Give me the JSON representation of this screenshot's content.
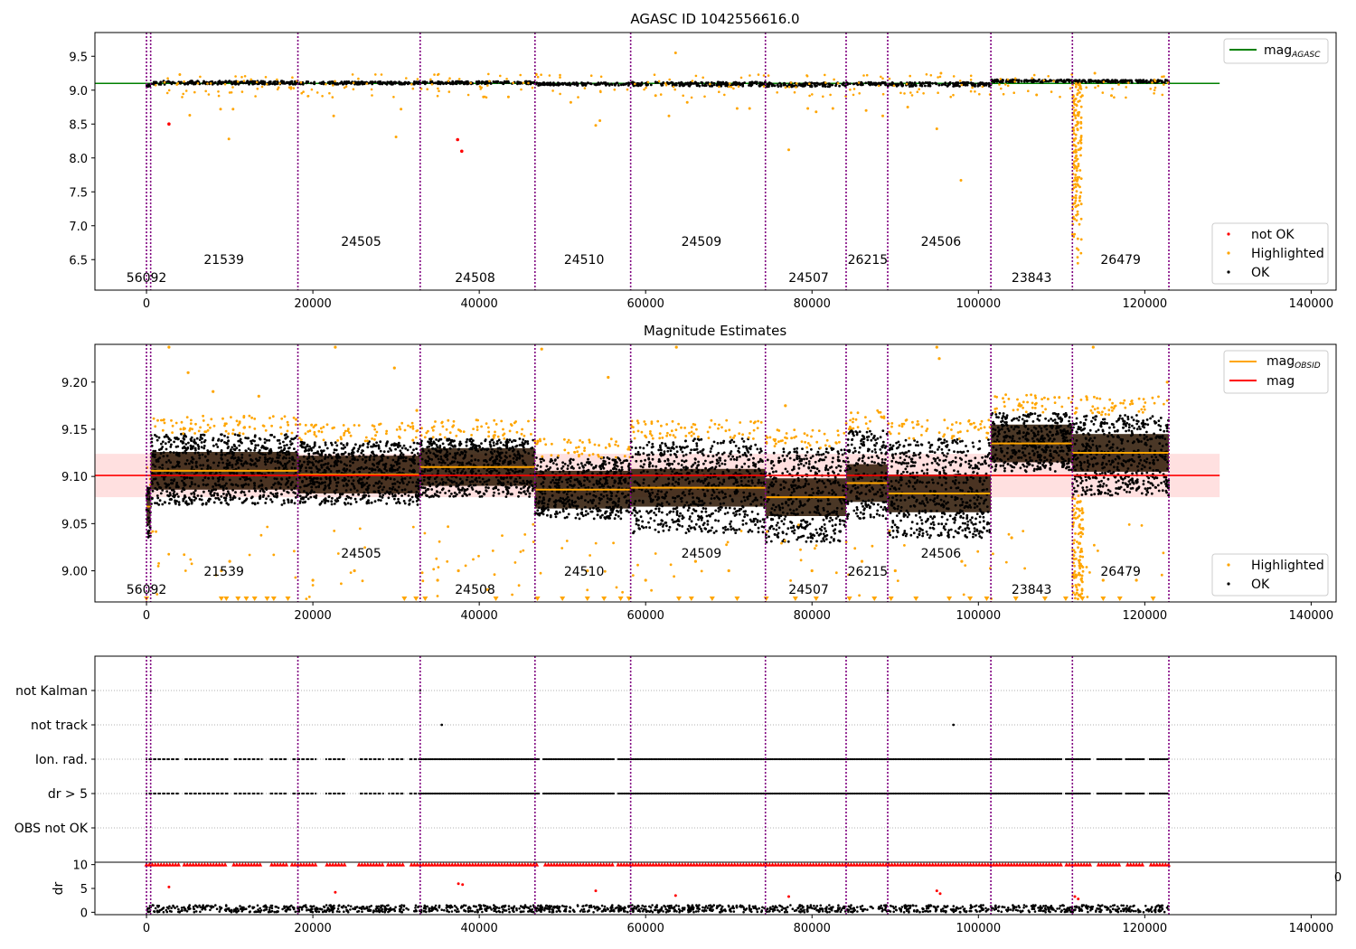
{
  "chart_data": [
    {
      "id": "agasc",
      "type": "scatter",
      "title": "AGASC ID 1042556616.0",
      "xlim": [
        -6200,
        143000
      ],
      "ylim": [
        6.05,
        9.85
      ],
      "xticks": [
        0,
        20000,
        40000,
        60000,
        80000,
        100000,
        120000,
        140000
      ],
      "yticks": [
        9.5,
        9.0,
        8.5,
        8.0,
        7.5,
        7.0,
        6.5
      ],
      "reference_line": {
        "name": "mag_AGASC",
        "value": 9.1,
        "x": [
          -6200,
          129000
        ],
        "color": "#008000"
      },
      "legend_line": {
        "label_main": "mag",
        "label_sub": "AGASC"
      },
      "legend_points": [
        {
          "label": "not OK",
          "color": "#ff0000"
        },
        {
          "label": "Highlighted",
          "color": "#ffa500"
        },
        {
          "label": "OK",
          "color": "#000000"
        }
      ],
      "segments": [
        {
          "x0": 0,
          "x1": 500,
          "median": 9.07,
          "spread": 0.02
        },
        {
          "x0": 500,
          "x1": 18200,
          "median": 9.11,
          "spread": 0.025
        },
        {
          "x0": 18200,
          "x1": 32900,
          "median": 9.105,
          "spread": 0.02
        },
        {
          "x0": 32900,
          "x1": 46700,
          "median": 9.11,
          "spread": 0.02
        },
        {
          "x0": 46700,
          "x1": 58200,
          "median": 9.09,
          "spread": 0.02
        },
        {
          "x0": 58200,
          "x1": 74400,
          "median": 9.09,
          "spread": 0.03
        },
        {
          "x0": 74400,
          "x1": 84100,
          "median": 9.08,
          "spread": 0.03
        },
        {
          "x0": 84100,
          "x1": 89100,
          "median": 9.095,
          "spread": 0.02
        },
        {
          "x0": 89100,
          "x1": 101500,
          "median": 9.085,
          "spread": 0.03
        },
        {
          "x0": 101500,
          "x1": 111300,
          "median": 9.135,
          "spread": 0.02
        },
        {
          "x0": 111300,
          "x1": 122900,
          "median": 9.13,
          "spread": 0.02
        }
      ],
      "not_ok_points": [
        [
          2700,
          8.5
        ],
        [
          37400,
          8.27
        ],
        [
          37900,
          8.1
        ]
      ],
      "highlighted_points": [
        [
          4000,
          9.23
        ],
        [
          5200,
          8.63
        ],
        [
          8900,
          8.72
        ],
        [
          9900,
          8.28
        ],
        [
          10400,
          8.72
        ],
        [
          22500,
          8.62
        ],
        [
          30000,
          8.31
        ],
        [
          30600,
          8.72
        ],
        [
          40500,
          8.9
        ],
        [
          43500,
          8.9
        ],
        [
          51000,
          8.82
        ],
        [
          54000,
          8.48
        ],
        [
          54500,
          8.55
        ],
        [
          61200,
          8.92
        ],
        [
          62800,
          8.62
        ],
        [
          63600,
          9.55
        ],
        [
          65000,
          8.82
        ],
        [
          71000,
          8.73
        ],
        [
          72500,
          8.73
        ],
        [
          77200,
          8.12
        ],
        [
          79500,
          8.73
        ],
        [
          80500,
          8.68
        ],
        [
          82500,
          8.73
        ],
        [
          86500,
          8.7
        ],
        [
          88500,
          8.62
        ],
        [
          91500,
          8.75
        ],
        [
          95000,
          8.43
        ],
        [
          95500,
          9.25
        ],
        [
          97900,
          7.67
        ],
        [
          107000,
          8.93
        ],
        [
          112500,
          8.92
        ],
        [
          114000,
          9.25
        ],
        [
          116000,
          8.92
        ]
      ],
      "dip": {
        "x0": 111300,
        "x1": 112400,
        "y_min": 6.35,
        "y_max": 9.1
      },
      "obsids": [
        {
          "label": "56092",
          "x": 0,
          "row": 0
        },
        {
          "label": "21539",
          "x": 9300,
          "row": 1
        },
        {
          "label": "24505",
          "x": 25800,
          "row": 2
        },
        {
          "label": "24508",
          "x": 39500,
          "row": 0
        },
        {
          "label": "24510",
          "x": 52600,
          "row": 1
        },
        {
          "label": "24509",
          "x": 66700,
          "row": 2
        },
        {
          "label": "24507",
          "x": 79600,
          "row": 0
        },
        {
          "label": "26215",
          "x": 86700,
          "row": 1
        },
        {
          "label": "24506",
          "x": 95500,
          "row": 2
        },
        {
          "label": "23843",
          "x": 106400,
          "row": 0
        },
        {
          "label": "26479",
          "x": 117100,
          "row": 1
        }
      ],
      "obsid_boundaries": [
        0,
        500,
        18200,
        32900,
        46700,
        58200,
        74400,
        84100,
        89100,
        101500,
        111300,
        122900
      ]
    },
    {
      "id": "mag_estimates",
      "type": "scatter",
      "title": "Magnitude Estimates",
      "xlim": [
        -6200,
        143000
      ],
      "ylim": [
        8.967,
        9.24
      ],
      "xticks": [
        0,
        20000,
        40000,
        60000,
        80000,
        100000,
        120000,
        140000
      ],
      "yticks": [
        9.2,
        9.15,
        9.1,
        9.05,
        9.0
      ],
      "mag_line": {
        "name": "mag",
        "value": 9.101,
        "band": [
          9.078,
          9.124
        ],
        "x": [
          -6200,
          129000
        ],
        "color": "#ff0000"
      },
      "legend_lines": [
        {
          "label_main": "mag",
          "label_sub": "OBSID",
          "color": "#ffa500"
        },
        {
          "label_main": "mag",
          "label_sub": "",
          "color": "#ff0000"
        }
      ],
      "legend_points": [
        {
          "label": "Highlighted",
          "color": "#ffa500"
        },
        {
          "label": "OK",
          "color": "#000000"
        }
      ],
      "segments": [
        {
          "x0": 0,
          "x1": 500,
          "mag_obsid": 9.068,
          "lo": 9.035,
          "hi": 9.09
        },
        {
          "x0": 500,
          "x1": 18200,
          "mag_obsid": 9.106,
          "lo": 9.07,
          "hi": 9.145
        },
        {
          "x0": 18200,
          "x1": 32900,
          "mag_obsid": 9.102,
          "lo": 9.07,
          "hi": 9.137
        },
        {
          "x0": 32900,
          "x1": 46700,
          "mag_obsid": 9.11,
          "lo": 9.078,
          "hi": 9.14
        },
        {
          "x0": 46700,
          "x1": 58200,
          "mag_obsid": 9.086,
          "lo": 9.055,
          "hi": 9.12
        },
        {
          "x0": 58200,
          "x1": 74400,
          "mag_obsid": 9.088,
          "lo": 9.04,
          "hi": 9.14
        },
        {
          "x0": 74400,
          "x1": 84100,
          "mag_obsid": 9.078,
          "lo": 9.03,
          "hi": 9.13
        },
        {
          "x0": 84100,
          "x1": 89100,
          "mag_obsid": 9.093,
          "lo": 9.055,
          "hi": 9.15
        },
        {
          "x0": 89100,
          "x1": 101500,
          "mag_obsid": 9.082,
          "lo": 9.035,
          "hi": 9.14
        },
        {
          "x0": 101500,
          "x1": 111300,
          "mag_obsid": 9.135,
          "lo": 9.105,
          "hi": 9.167
        },
        {
          "x0": 111300,
          "x1": 122900,
          "mag_obsid": 9.125,
          "lo": 9.08,
          "hi": 9.165
        }
      ],
      "highlighted_points": [
        [
          2700,
          9.237
        ],
        [
          5000,
          9.21
        ],
        [
          8000,
          9.19
        ],
        [
          9000,
          9.0
        ],
        [
          10000,
          9.01
        ],
        [
          13500,
          9.185
        ],
        [
          20000,
          8.99
        ],
        [
          22700,
          9.237
        ],
        [
          25000,
          9.0
        ],
        [
          29800,
          9.215
        ],
        [
          32500,
          9.17
        ],
        [
          35000,
          8.99
        ],
        [
          37500,
          9.0
        ],
        [
          41000,
          8.98
        ],
        [
          47500,
          9.235
        ],
        [
          53000,
          9.0
        ],
        [
          55500,
          9.205
        ],
        [
          60000,
          8.99
        ],
        [
          63700,
          9.237
        ],
        [
          66000,
          9.01
        ],
        [
          70000,
          9.0
        ],
        [
          76800,
          9.175
        ],
        [
          80000,
          9.0
        ],
        [
          86000,
          9.01
        ],
        [
          90000,
          9.0
        ],
        [
          95000,
          9.237
        ],
        [
          95300,
          9.225
        ],
        [
          98000,
          9.01
        ],
        [
          104000,
          9.035
        ],
        [
          113800,
          9.237
        ],
        [
          115000,
          8.99
        ],
        [
          119000,
          8.99
        ],
        [
          122700,
          9.2
        ]
      ],
      "dip": {
        "x0": 111300,
        "x1": 112600,
        "y_min": 8.97,
        "y_max": 9.08
      },
      "clipped_low_x": [
        0,
        9000,
        9600,
        11000,
        12000,
        13000,
        14500,
        15300,
        17000,
        31000,
        32400,
        33500,
        42000,
        47000,
        50000,
        53000,
        55000,
        57000,
        58000,
        64000,
        65500,
        68000,
        71000,
        74500,
        78000,
        80500,
        84500,
        87500,
        89500,
        92500,
        96500,
        99000,
        101000,
        104500,
        108000,
        110500,
        112500,
        115000,
        117000,
        121000
      ],
      "obsids": [
        {
          "label": "56092",
          "x": 0,
          "row": 0
        },
        {
          "label": "21539",
          "x": 9300,
          "row": 1
        },
        {
          "label": "24505",
          "x": 25800,
          "row": 2
        },
        {
          "label": "24508",
          "x": 39500,
          "row": 0
        },
        {
          "label": "24510",
          "x": 52600,
          "row": 1
        },
        {
          "label": "24509",
          "x": 66700,
          "row": 2
        },
        {
          "label": "24507",
          "x": 79600,
          "row": 0
        },
        {
          "label": "26215",
          "x": 86700,
          "row": 1
        },
        {
          "label": "24506",
          "x": 95500,
          "row": 2
        },
        {
          "label": "23843",
          "x": 106400,
          "row": 0
        },
        {
          "label": "26479",
          "x": 117100,
          "row": 1
        }
      ],
      "obsid_boundaries": [
        0,
        500,
        18200,
        32900,
        46700,
        58200,
        74400,
        84100,
        89100,
        101500,
        111300,
        122900
      ]
    },
    {
      "id": "flags",
      "type": "scatter",
      "xlim": [
        -6200,
        143000
      ],
      "categories": [
        "not Kalman",
        "not track",
        "Ion. rad.",
        "dr > 5",
        "OBS not OK"
      ],
      "points": {
        "not Kalman": [
          500,
          32900,
          89100
        ],
        "not track": [
          35500,
          97000
        ],
        "Ion. rad.": {
          "ranges": [
            [
              0,
              122900
            ]
          ],
          "gaps": [
            [
              4000,
              4500
            ],
            [
              9800,
              10400
            ],
            [
              14000,
              14800
            ],
            [
              17000,
              17400
            ],
            [
              20500,
              21500
            ],
            [
              24000,
              25400
            ],
            [
              28500,
              29000
            ],
            [
              31000,
              31500
            ],
            [
              47200,
              47600
            ],
            [
              56200,
              56600
            ],
            [
              110000,
              110500
            ],
            [
              113500,
              114200
            ],
            [
              117200,
              117600
            ],
            [
              120000,
              120500
            ]
          ]
        },
        "dr > 5": {
          "ranges": [
            [
              0,
              122900
            ]
          ],
          "gaps": [
            [
              4000,
              4500
            ],
            [
              9800,
              10400
            ],
            [
              14000,
              14800
            ],
            [
              17000,
              17400
            ],
            [
              20500,
              21500
            ],
            [
              24000,
              25400
            ],
            [
              28500,
              29000
            ],
            [
              31000,
              31500
            ],
            [
              47200,
              47600
            ],
            [
              56200,
              56600
            ],
            [
              110000,
              110500
            ],
            [
              113500,
              114200
            ],
            [
              117200,
              117600
            ],
            [
              120000,
              120500
            ]
          ]
        },
        "OBS not OK": []
      },
      "obsid_boundaries": [
        0,
        500,
        18200,
        32900,
        46700,
        58200,
        74400,
        84100,
        89100,
        101500,
        111300,
        122900
      ]
    },
    {
      "id": "dr",
      "type": "scatter",
      "ylabel": "dr",
      "xlim": [
        -6200,
        143000
      ],
      "ylim": [
        -0.5,
        10.5
      ],
      "xticks": [
        0,
        20000,
        40000,
        60000,
        80000,
        100000,
        120000,
        140000
      ],
      "yticks": [
        10,
        5,
        0
      ],
      "clipped_value": 10,
      "ok_band": [
        0,
        1.5
      ],
      "not_ok_points": [
        [
          2700,
          5.3
        ],
        [
          22700,
          4.2
        ],
        [
          37500,
          6.0
        ],
        [
          38000,
          5.8
        ],
        [
          54000,
          4.5
        ],
        [
          63600,
          3.5
        ],
        [
          77200,
          3.3
        ],
        [
          95000,
          4.5
        ],
        [
          95400,
          3.9
        ],
        [
          111600,
          3.3
        ],
        [
          112000,
          2.8
        ]
      ],
      "obsid_boundaries": [
        0,
        500,
        18200,
        32900,
        46700,
        58200,
        74400,
        84100,
        89100,
        101500,
        111300,
        122900
      ],
      "edge_label": "0"
    }
  ],
  "colors": {
    "ok": "#000000",
    "highlighted": "#ffa500",
    "not_ok": "#ff0000",
    "agasc_line": "#008000",
    "obsid_line": "#ffa500",
    "mag_line": "#ff0000",
    "boundary": "#800080"
  }
}
